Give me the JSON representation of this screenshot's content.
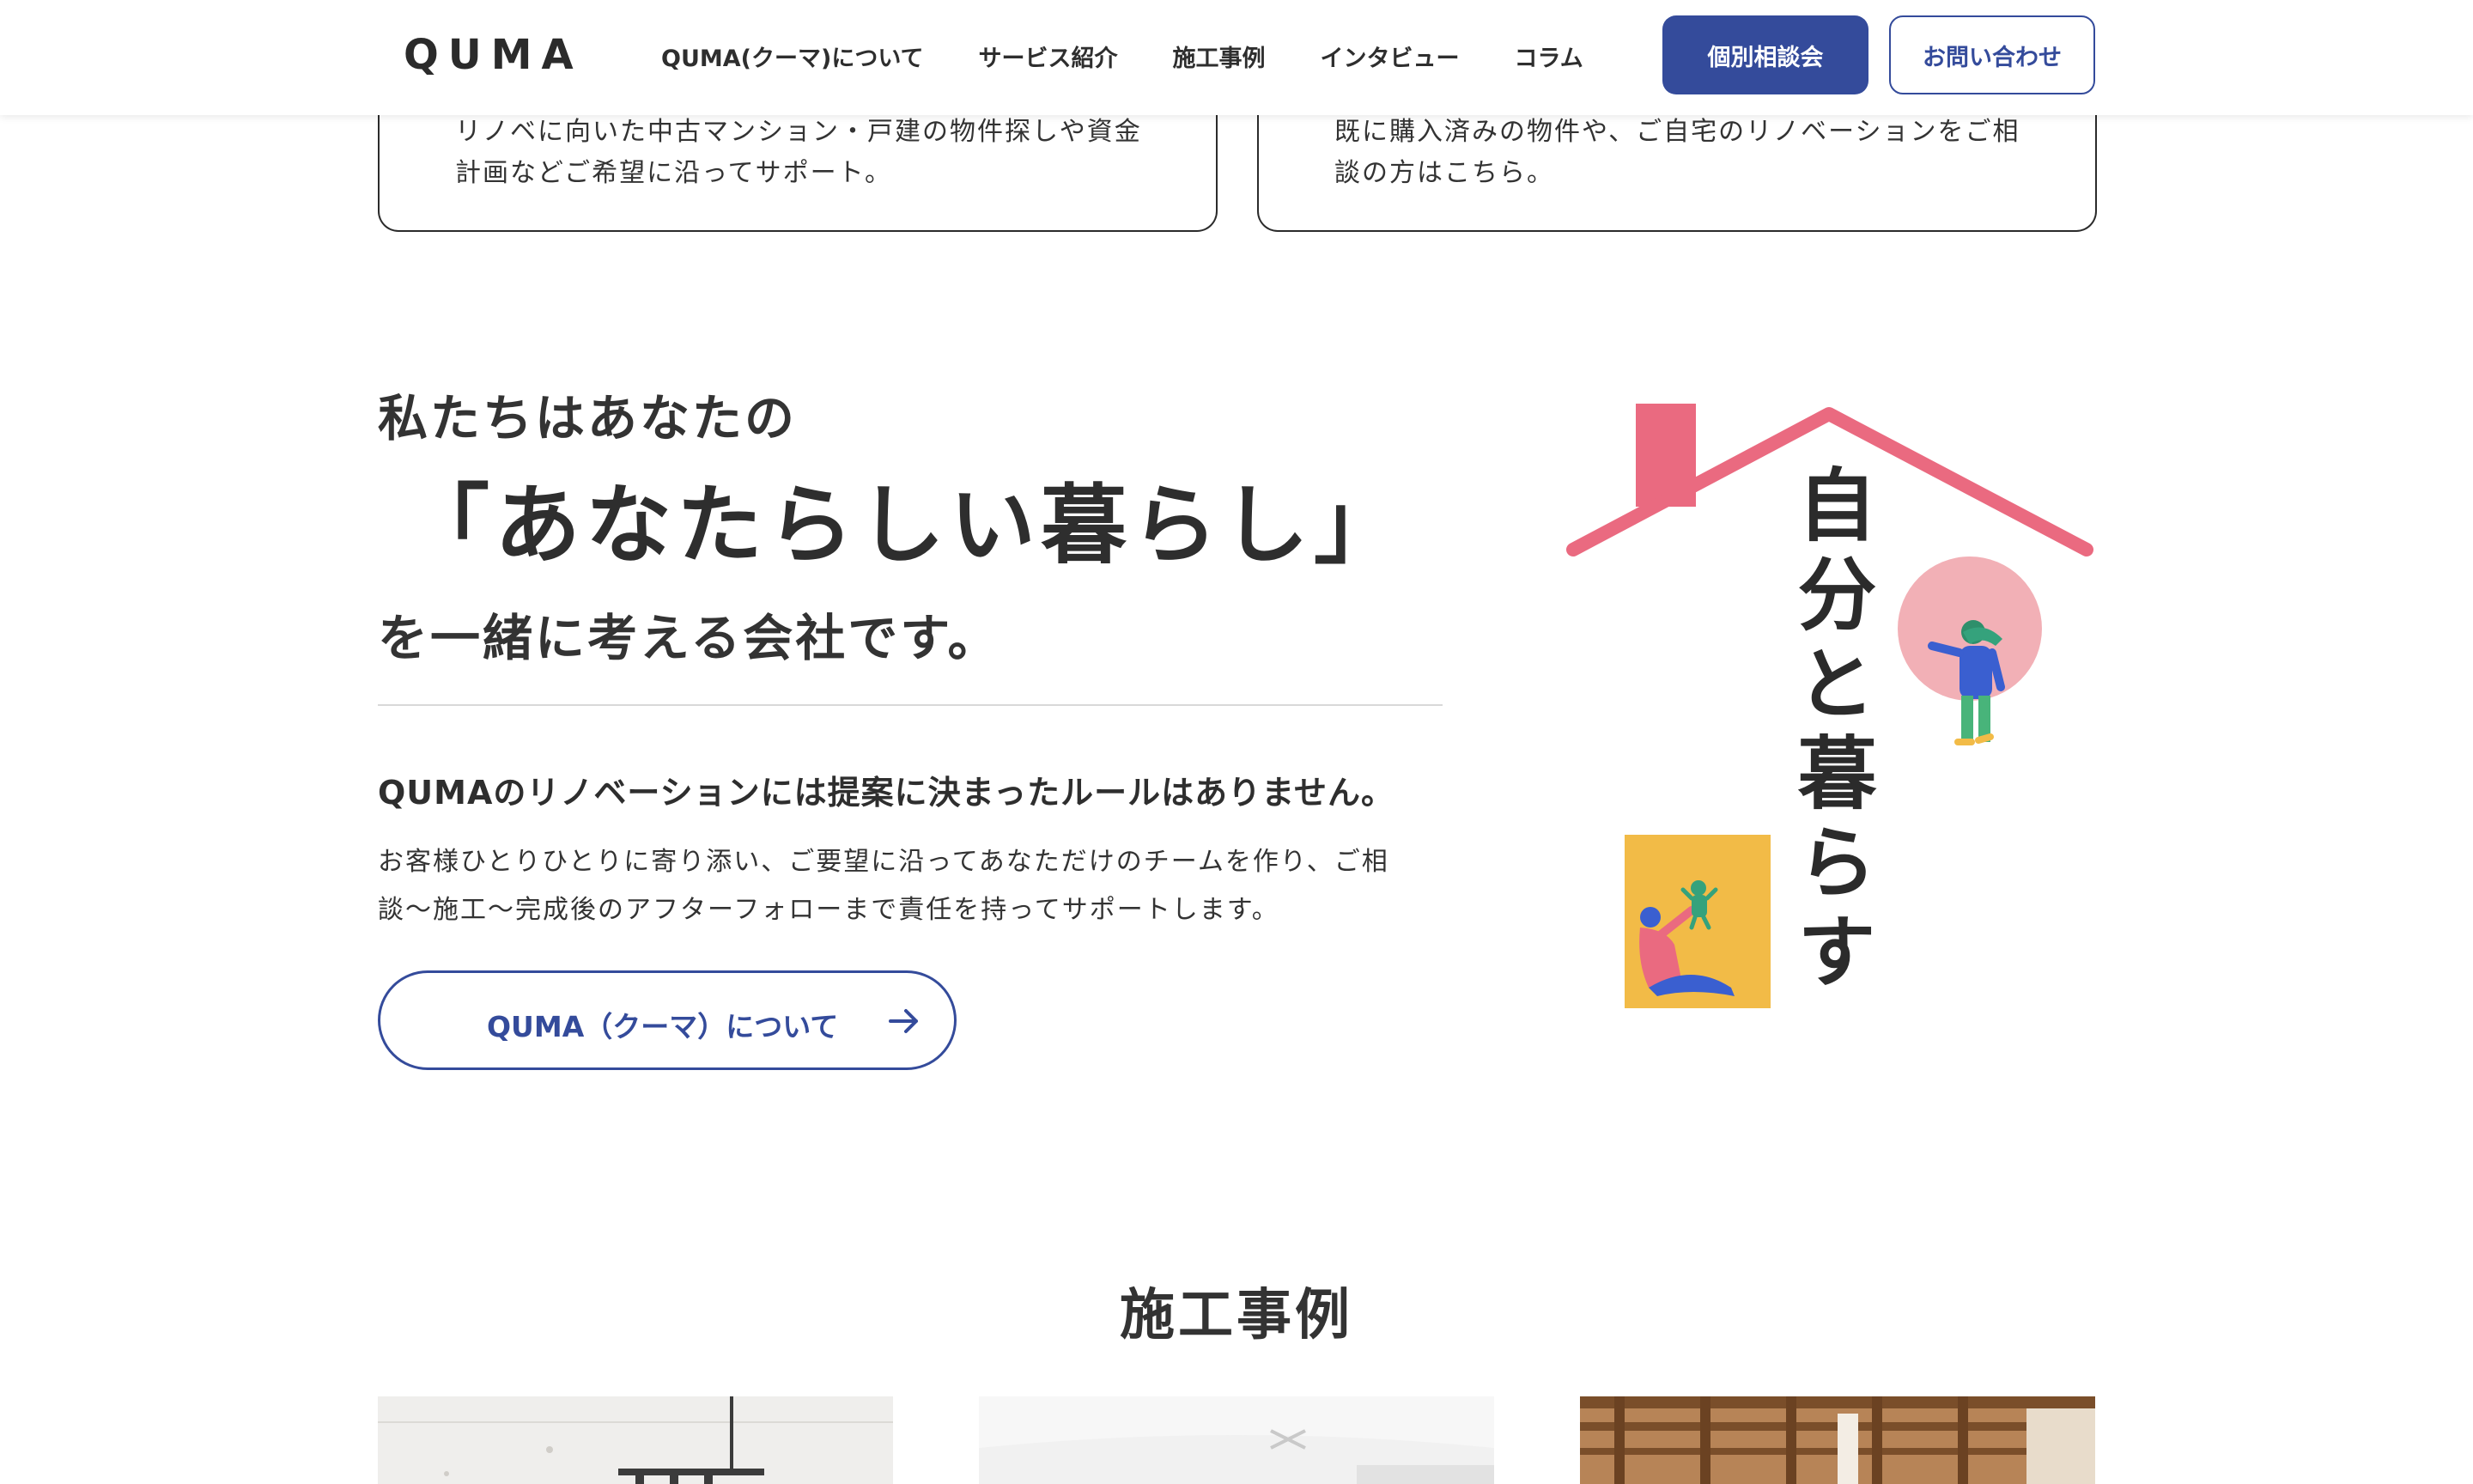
{
  "header": {
    "logo": "QUMA",
    "nav": [
      "QUMA(クーマ)について",
      "サービス紹介",
      "施工事例",
      "インタビュー",
      "コラム"
    ],
    "consult_button": "個別相談会",
    "contact_button": "お問い合わせ"
  },
  "cards": [
    {
      "text": "リノベに向いた中古マンション・戸建の物件探しや資金計画などご希望に沿ってサポート。"
    },
    {
      "text": "既に購入済みの物件や、ご自宅のリノベーションをご相談の方はこちら。"
    }
  ],
  "about": {
    "lead": "私たちはあなたの",
    "main": "「あなたらしい暮らし」",
    "tail": "を一緒に考える会社です。",
    "heading": "QUMAのリノベーションには提案に決まったルールはありません。",
    "body": "お客様ひとりひとりに寄り添い、ご要望に沿ってあなただけのチームを作り、ご相談〜施工〜完成後のアフターフォローまで責任を持ってサポートします。",
    "button_label": "QUMA（クーマ）について",
    "illustration_text": "自分と暮らす"
  },
  "works": {
    "title": "施工事例"
  },
  "colors": {
    "brand": "#344b9b",
    "roof": "#ea6a80",
    "pink_circle": "#f2b0b6",
    "yellow": "#f2bb47"
  }
}
